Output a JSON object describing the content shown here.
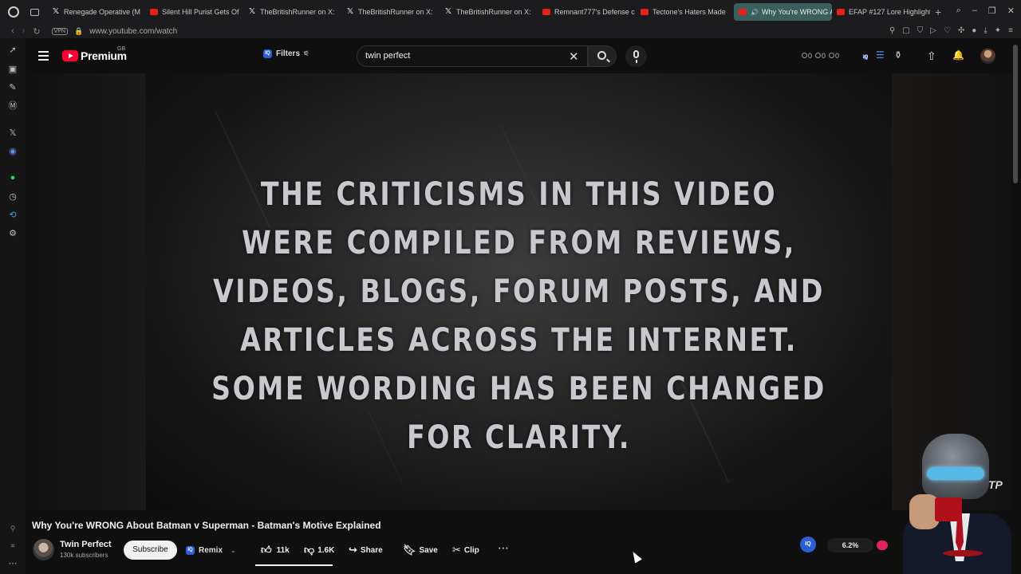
{
  "browser": {
    "tabs": [
      {
        "icon": "x-icon",
        "label": "Renegade Operative (M"
      },
      {
        "icon": "youtube-icon",
        "label": "Silent Hill Purist Gets Of"
      },
      {
        "icon": "x-icon",
        "label": "TheBritishRunner on X:"
      },
      {
        "icon": "x-icon",
        "label": "TheBritishRunner on X:"
      },
      {
        "icon": "x-icon",
        "label": "TheBritishRunner on X:"
      },
      {
        "icon": "youtube-icon",
        "label": "Remnant777's Defense c"
      },
      {
        "icon": "youtube-icon",
        "label": "Tectone's Haters Made"
      },
      {
        "icon": "youtube-icon",
        "label": "Why You're WRONG A",
        "active": true
      },
      {
        "icon": "youtube-icon",
        "label": "EFAP #127 Lore Highlight"
      }
    ],
    "new_tab": "+",
    "vpn_label": "VPN",
    "url": "www.youtube.com/watch"
  },
  "header": {
    "brand": "Premium",
    "country": "GB",
    "filters_label": "Filters",
    "iq_label": "IQ",
    "search_value": "twin perfect",
    "stat_counts": [
      "0",
      "0",
      "0"
    ]
  },
  "video": {
    "overlay_text": "The criticisms in this video were compiled from reviews, videos, blogs, forum posts, and articles across the internet. Some wording has been changed for clarity.",
    "title": "Why You're WRONG About Batman v Superman - Batman's Motive Explained",
    "channel_name": "Twin Perfect",
    "subscribers": "130k subscribers",
    "subscribe_label": "Subscribe",
    "remix_label": "Remix",
    "likes": "11k",
    "dislikes": "1.6K",
    "share_label": "Share",
    "save_label": "Save",
    "clip_label": "Clip"
  },
  "widget": {
    "iq_label": "IQ",
    "percent": "6.2%"
  },
  "webcam": {
    "logo_text": "TP"
  },
  "colors": {
    "youtube_red": "#ff0033",
    "iq_blue": "#2a5fd6",
    "active_tab": "#3b5f5c"
  }
}
